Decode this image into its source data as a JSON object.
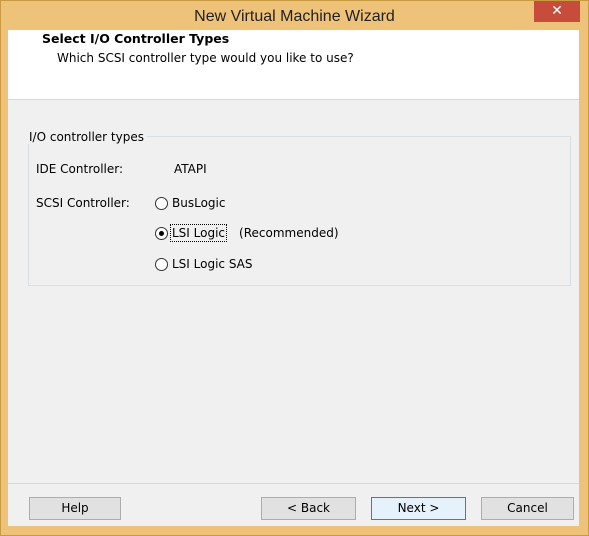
{
  "window": {
    "title": "New Virtual Machine Wizard",
    "close_symbol": "✕"
  },
  "header": {
    "title": "Select I/O Controller Types",
    "subtitle": "Which SCSI controller type would you like to use?"
  },
  "group": {
    "legend": "I/O controller types",
    "ide_label": "IDE Controller:",
    "ide_value": "ATAPI",
    "scsi_label": "SCSI Controller:",
    "options": [
      {
        "label": "BusLogic",
        "selected": false
      },
      {
        "label": "LSI Logic",
        "selected": true,
        "note": "(Recommended)"
      },
      {
        "label": "LSI Logic SAS",
        "selected": false
      }
    ]
  },
  "buttons": {
    "help": "Help",
    "back": "< Back",
    "next": "Next >",
    "cancel": "Cancel"
  },
  "colors": {
    "titlebar": "#efc27a",
    "close": "#c74c3c"
  }
}
